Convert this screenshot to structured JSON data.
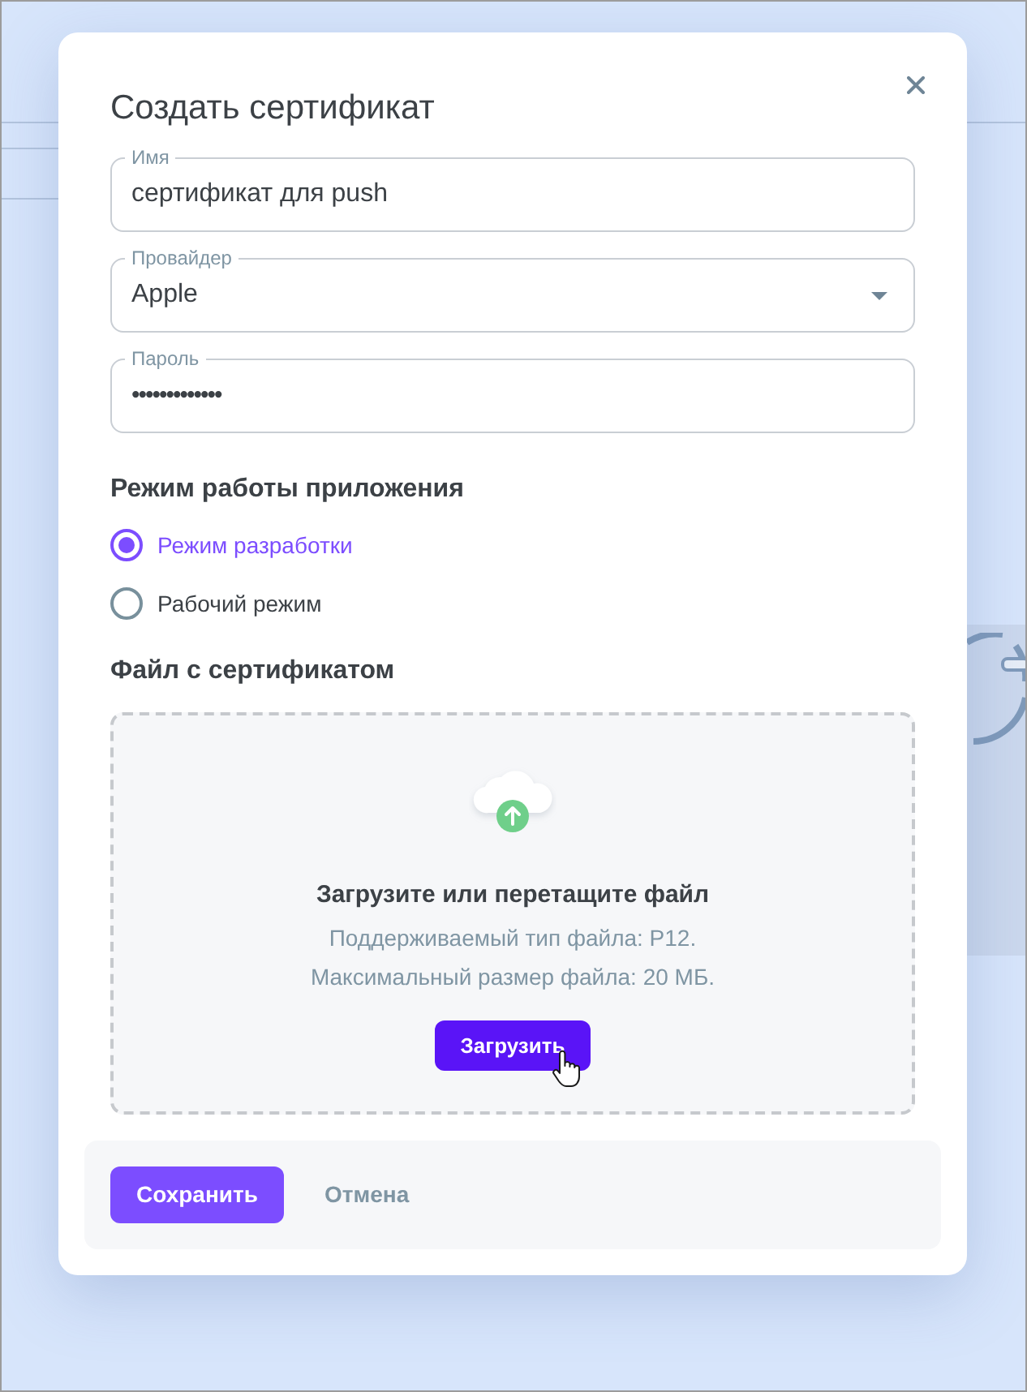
{
  "dialog": {
    "title": "Создать сертификат",
    "fields": [
      {
        "kind": "text",
        "label": "Имя",
        "value": "сертификат для push"
      },
      {
        "kind": "select",
        "label": "Провайдер",
        "value": "Apple"
      },
      {
        "kind": "password",
        "label": "Пароль",
        "value": "•••••••••••••"
      }
    ],
    "mode": {
      "heading": "Режим работы приложения",
      "options": [
        {
          "label": "Режим разработки",
          "selected": true
        },
        {
          "label": "Рабочий режим",
          "selected": false
        }
      ]
    },
    "upload": {
      "heading": "Файл с сертификатом",
      "title": "Загрузите или перетащите файл",
      "hints": [
        "Поддерживаемый тип файла: P12.",
        "Максимальный размер файла: 20 МБ."
      ],
      "button": "Загрузить"
    },
    "buttons": [
      {
        "kind": "primary",
        "label": "Сохранить"
      },
      {
        "kind": "text",
        "label": "Отмена"
      }
    ]
  }
}
